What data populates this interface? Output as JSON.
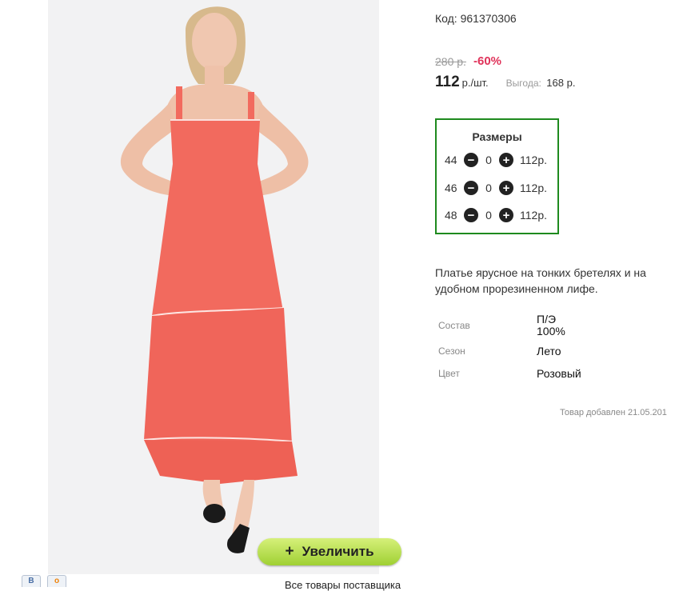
{
  "product": {
    "code_label": "Код: 961370306",
    "old_price": "280 р.",
    "discount": "-60%",
    "price": "112",
    "price_unit": "р./шт.",
    "savings_label": "Выгода:",
    "savings_value": "168 р."
  },
  "sizes": {
    "title": "Размеры",
    "rows": [
      {
        "size": "44",
        "qty": "0",
        "price": "112р."
      },
      {
        "size": "46",
        "qty": "0",
        "price": "112р."
      },
      {
        "size": "48",
        "qty": "0",
        "price": "112р."
      }
    ],
    "minus_symbol": "−",
    "plus_symbol": "+"
  },
  "description": "Платье ярусное на тонких бретелях и на удобном прорезиненном лифе.",
  "attributes": [
    {
      "label": "Состав",
      "value_line1": "П/Э",
      "value_line2": "100%"
    },
    {
      "label": "Сезон",
      "value": "Лето"
    },
    {
      "label": "Цвет",
      "value": "Розовый"
    }
  ],
  "added_text": "Товар добавлен 21.05.201",
  "zoom_button": {
    "plus": "+",
    "label": "Увеличить"
  },
  "share": {
    "vk": "В",
    "ok": "о"
  },
  "supplier_link": "Все товары поставщика",
  "colors": {
    "accent_green": "#1e8a1e",
    "discount_red": "#e0335a",
    "dress": "#f26a5e"
  }
}
